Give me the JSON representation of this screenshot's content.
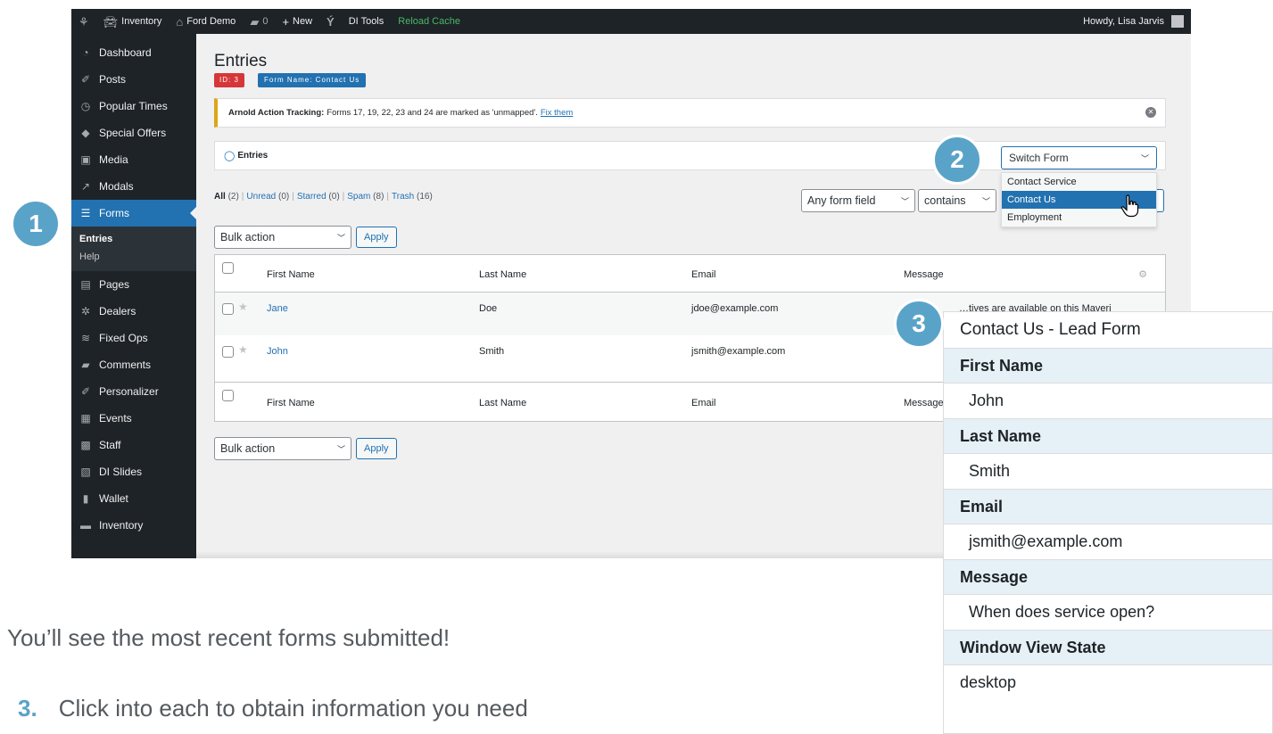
{
  "admin_bar": {
    "wp_icon": "wordpress-logo-icon",
    "items": [
      {
        "icon": "car-icon",
        "label": "Inventory"
      },
      {
        "icon": "home-icon",
        "label": "Ford Demo"
      },
      {
        "icon": "comment-icon",
        "label": "0"
      },
      {
        "icon": "plus-icon",
        "label": "New"
      },
      {
        "icon": "yoast-icon",
        "label": ""
      },
      {
        "icon": "",
        "label": "DI Tools"
      },
      {
        "icon": "",
        "label": "Reload Cache"
      }
    ],
    "howdy": "Howdy, Lisa Jarvis",
    "reload_color": "#4ab866"
  },
  "sidebar": {
    "items": [
      {
        "icon": "dashboard-icon",
        "label": "Dashboard"
      },
      {
        "icon": "pin-icon",
        "label": "Posts"
      },
      {
        "icon": "clock-icon",
        "label": "Popular Times"
      },
      {
        "icon": "tag-icon",
        "label": "Special Offers"
      },
      {
        "icon": "media-icon",
        "label": "Media"
      },
      {
        "icon": "external-icon",
        "label": "Modals"
      },
      {
        "icon": "forms-icon",
        "label": "Forms"
      }
    ],
    "submenu": [
      "Entries",
      "Help"
    ],
    "items_after": [
      {
        "icon": "page-icon",
        "label": "Pages"
      },
      {
        "icon": "dealers-icon",
        "label": "Dealers"
      },
      {
        "icon": "wrench-icon",
        "label": "Fixed Ops"
      },
      {
        "icon": "comment-icon",
        "label": "Comments"
      },
      {
        "icon": "pin-icon",
        "label": "Personalizer"
      },
      {
        "icon": "calendar-icon",
        "label": "Events"
      },
      {
        "icon": "staff-icon",
        "label": "Staff"
      },
      {
        "icon": "slides-icon",
        "label": "DI Slides"
      },
      {
        "icon": "wallet-icon",
        "label": "Wallet"
      },
      {
        "icon": "car-icon",
        "label": "Inventory"
      }
    ],
    "active_color": "#2271b1"
  },
  "main": {
    "title": "Entries",
    "badge_id": "ID: 3",
    "badge_form": "Form Name: Contact Us",
    "notice": {
      "bold": "Arnold Action Tracking:",
      "text": "Forms 17, 19, 22, 23 and 24 are marked as 'unmapped'.",
      "link": "Fix them"
    },
    "entries_box_label": "Entries",
    "switch_form": {
      "placeholder": "Switch Form",
      "options": [
        "Contact Service",
        "Contact Us",
        "Employment"
      ],
      "selected": "Contact Us"
    },
    "filters": {
      "all": "All",
      "all_count": "(2)",
      "unread": "Unread",
      "unread_count": "(0)",
      "starred": "Starred",
      "starred_count": "(0)",
      "spam": "Spam",
      "spam_count": "(8)",
      "trash": "Trash",
      "trash_count": "(16)"
    },
    "search": {
      "field": "Any form field",
      "operator": "contains"
    },
    "bulk_action": "Bulk action",
    "apply": "Apply",
    "table": {
      "columns": [
        "First Name",
        "Last Name",
        "Email",
        "Message"
      ],
      "rows": [
        {
          "first": "Jane",
          "last": "Doe",
          "email": "jdoe@example.com",
          "message": "…tives are available on this Maveri"
        },
        {
          "first": "John",
          "last": "Smith",
          "email": "jsmith@example.com",
          "message": ""
        }
      ],
      "footer_message_partial": "Message"
    }
  },
  "steps": [
    "1",
    "2",
    "3"
  ],
  "detail_panel": {
    "title": "Contact Us -  Lead Form",
    "fields": [
      {
        "label": "First Name",
        "value": "John"
      },
      {
        "label": "Last Name",
        "value": "Smith"
      },
      {
        "label": "Email",
        "value": "jsmith@example.com"
      },
      {
        "label": "Message",
        "value": "When does service open?"
      },
      {
        "label": "Window View State",
        "value": "desktop"
      }
    ]
  },
  "caption": {
    "line": "You’ll see the most recent forms submitted!",
    "step_number": "3.",
    "step_text": "Click into each to obtain information you need"
  },
  "colors": {
    "step_circle": "#5aa3c8",
    "panel_label_bg": "#e6f0f7",
    "wp_dark": "#1d2327"
  }
}
